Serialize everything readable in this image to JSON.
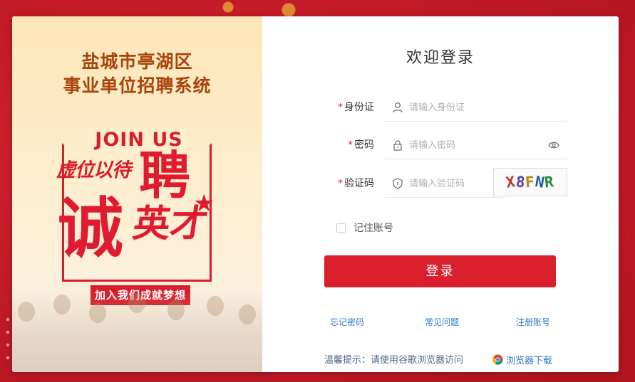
{
  "banner": {
    "title_line1": "盐城市亭湖区",
    "title_line2": "事业单位招聘系统",
    "poster": {
      "join_us": "JOIN US",
      "slogan_small": "虚位以待",
      "big_pin": "聘",
      "big_cheng": "诚",
      "big_yingcai": "英才",
      "ribbon": "加入我们成就梦想"
    }
  },
  "form": {
    "title": "欢迎登录",
    "required_mark": "*",
    "id_card": {
      "label": "身份证",
      "placeholder": "请输入身份证",
      "icon": "user-icon"
    },
    "password": {
      "label": "密码",
      "placeholder": "请输入密码",
      "icon": "lock-icon",
      "toggle_icon": "eye-icon"
    },
    "captcha": {
      "label": "验证码",
      "placeholder": "请输入验证码",
      "icon": "shield-icon",
      "code": [
        "X",
        "8",
        "F",
        "N",
        "R"
      ]
    },
    "remember_label": "记住账号",
    "remember_checked": false,
    "login_button": "登录",
    "links": {
      "forgot": "忘记密码",
      "faq": "常见问题",
      "register": "注册账号"
    },
    "tip": "温馨提示：请使用谷歌浏览器访问",
    "browser_download": "浏览器下载"
  },
  "colors": {
    "primary": "#d9202c",
    "link": "#2b78c8",
    "banner_title": "#a8430b"
  }
}
